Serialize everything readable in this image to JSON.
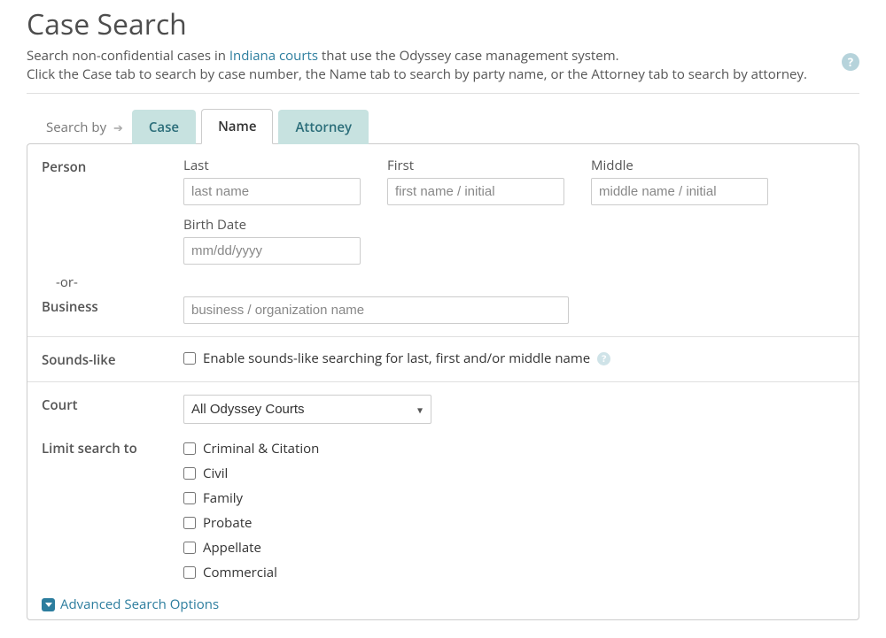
{
  "header": {
    "title": "Case Search",
    "intro_before_link": "Search non-confidential cases in ",
    "intro_link_text": "Indiana courts",
    "intro_after_link": " that use the Odyssey case management system.",
    "intro_line2": "Click the Case tab to search by case number, the Name tab to search by party name, or the Attorney tab to search by attorney.",
    "help_glyph": "?"
  },
  "tabs": {
    "search_by_label": "Search by",
    "arrow": "➔",
    "items": [
      "Case",
      "Name",
      "Attorney"
    ],
    "active_index": 1
  },
  "person": {
    "section_label": "Person",
    "last_label": "Last",
    "last_placeholder": "last name",
    "first_label": "First",
    "first_placeholder": "first name / initial",
    "middle_label": "Middle",
    "middle_placeholder": "middle name / initial",
    "birth_label": "Birth Date",
    "birth_placeholder": "mm/dd/yyyy"
  },
  "or_text": "-or-",
  "business": {
    "section_label": "Business",
    "placeholder": "business / organization name"
  },
  "sounds": {
    "section_label": "Sounds-like",
    "checkbox_label": "Enable sounds-like searching for last, first and/or middle name",
    "help_glyph": "?"
  },
  "court": {
    "section_label": "Court",
    "selected": "All Odyssey Courts"
  },
  "limit": {
    "section_label": "Limit search to",
    "options": [
      "Criminal & Citation",
      "Civil",
      "Family",
      "Probate",
      "Appellate",
      "Commercial"
    ]
  },
  "advanced": {
    "label": "Advanced Search Options"
  }
}
